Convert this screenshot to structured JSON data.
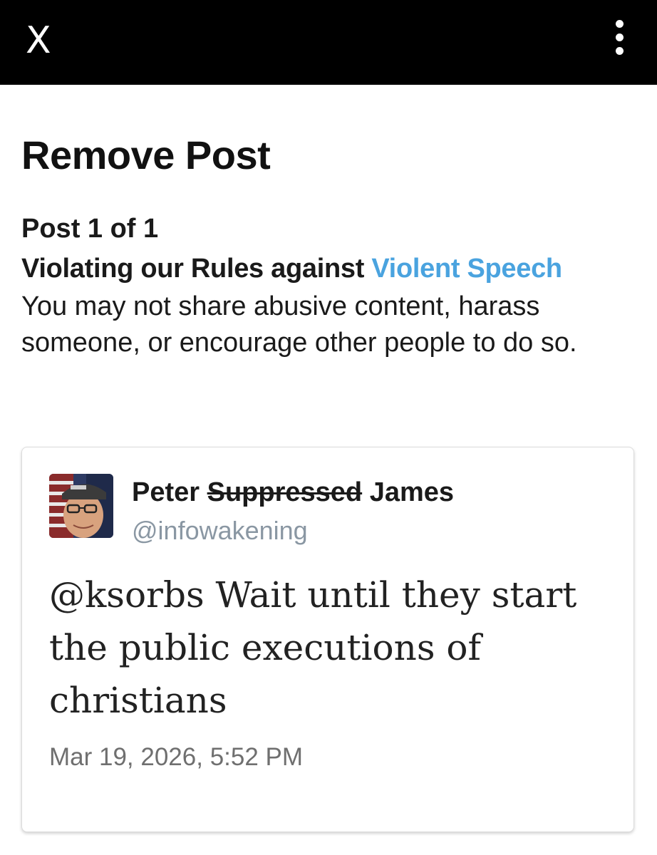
{
  "topbar": {
    "close_label": "X",
    "close_icon": "close-icon",
    "more_icon": "more-vertical-icon"
  },
  "page": {
    "title": "Remove Post",
    "post_count": "Post 1 of 1",
    "violation_prefix": "Violating our Rules against ",
    "violation_rule": "Violent Speech",
    "description": "You may not share abusive content, harass someone, or encourage other people to do so."
  },
  "post": {
    "author_first": "Peter",
    "author_struck": "Suppressed",
    "author_last": "James",
    "handle": "@infowakening",
    "text": "@ksorbs Wait until they start the public executions of christians",
    "timestamp": "Mar 19, 2026, 5:52 PM"
  },
  "colors": {
    "topbar": "#000000",
    "link": "#4aa3df",
    "handle": "#8a97a3",
    "timestamp": "#6f6f6f"
  }
}
